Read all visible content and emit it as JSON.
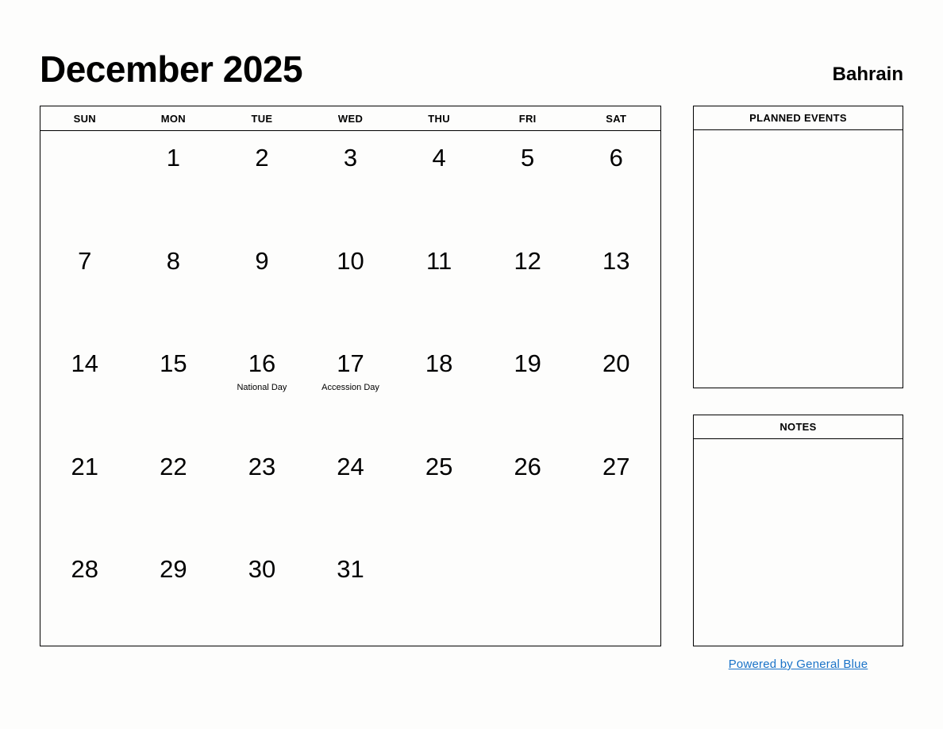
{
  "header": {
    "title": "December 2025",
    "country": "Bahrain"
  },
  "calendar": {
    "weekdays": [
      "SUN",
      "MON",
      "TUE",
      "WED",
      "THU",
      "FRI",
      "SAT"
    ],
    "weeks": [
      [
        {
          "day": ""
        },
        {
          "day": "1"
        },
        {
          "day": "2"
        },
        {
          "day": "3"
        },
        {
          "day": "4"
        },
        {
          "day": "5"
        },
        {
          "day": "6"
        }
      ],
      [
        {
          "day": "7"
        },
        {
          "day": "8"
        },
        {
          "day": "9"
        },
        {
          "day": "10"
        },
        {
          "day": "11"
        },
        {
          "day": "12"
        },
        {
          "day": "13"
        }
      ],
      [
        {
          "day": "14"
        },
        {
          "day": "15"
        },
        {
          "day": "16",
          "event": "National Day"
        },
        {
          "day": "17",
          "event": "Accession Day"
        },
        {
          "day": "18"
        },
        {
          "day": "19"
        },
        {
          "day": "20"
        }
      ],
      [
        {
          "day": "21"
        },
        {
          "day": "22"
        },
        {
          "day": "23"
        },
        {
          "day": "24"
        },
        {
          "day": "25"
        },
        {
          "day": "26"
        },
        {
          "day": "27"
        }
      ],
      [
        {
          "day": "28"
        },
        {
          "day": "29"
        },
        {
          "day": "30"
        },
        {
          "day": "31"
        },
        {
          "day": ""
        },
        {
          "day": ""
        },
        {
          "day": ""
        }
      ]
    ]
  },
  "panels": {
    "planned_events": {
      "title": "PLANNED EVENTS",
      "content": ""
    },
    "notes": {
      "title": "NOTES",
      "content": ""
    }
  },
  "footer": {
    "link_text": "Powered by General Blue",
    "link_color": "#1a73c8"
  }
}
